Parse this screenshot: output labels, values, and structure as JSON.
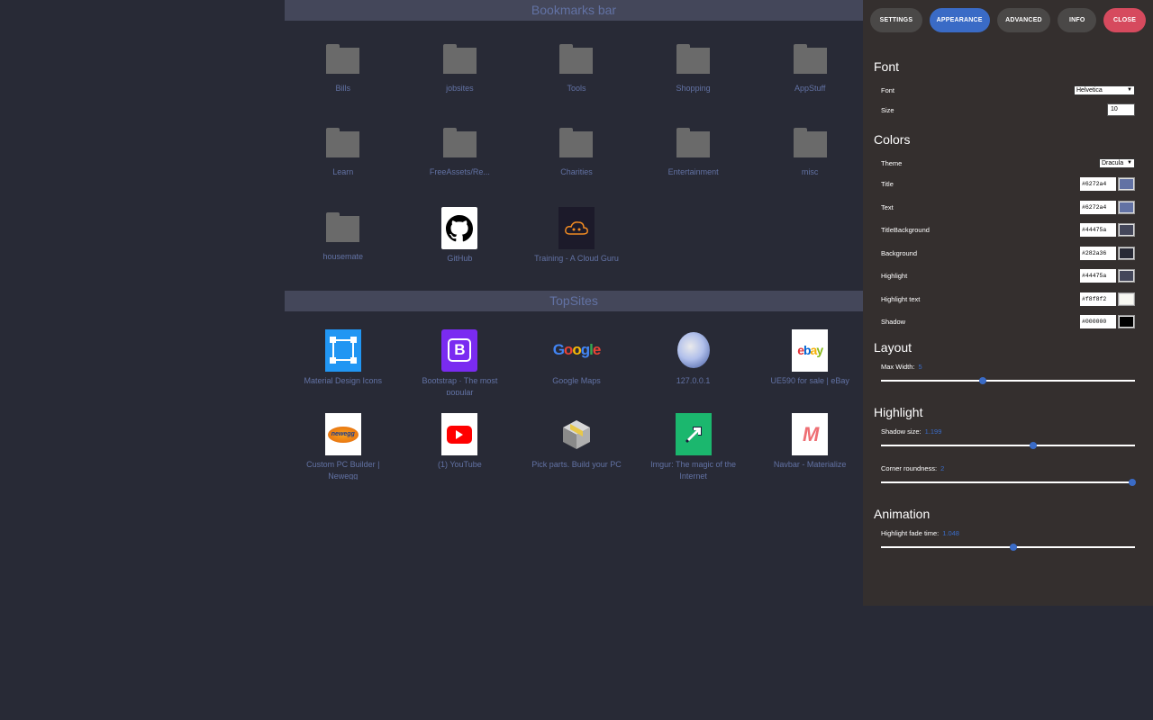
{
  "bookmarks": {
    "header": "Bookmarks bar",
    "items": [
      {
        "label": "Bills",
        "icon": "folder-icon"
      },
      {
        "label": "jobsites",
        "icon": "folder-icon"
      },
      {
        "label": "Tools",
        "icon": "folder-icon"
      },
      {
        "label": "Shopping",
        "icon": "folder-icon"
      },
      {
        "label": "AppStuff",
        "icon": "folder-icon"
      },
      {
        "label": "Learn",
        "icon": "folder-icon"
      },
      {
        "label": "FreeAssets/Re...",
        "icon": "folder-icon"
      },
      {
        "label": "Charities",
        "icon": "folder-icon"
      },
      {
        "label": "Entertainment",
        "icon": "folder-icon"
      },
      {
        "label": "misc",
        "icon": "folder-icon"
      },
      {
        "label": "housemate",
        "icon": "folder-icon"
      },
      {
        "label": "GitHub",
        "icon": "github-icon"
      },
      {
        "label": "Training - A Cloud Guru",
        "icon": "acloudguru-icon"
      }
    ]
  },
  "topsites": {
    "header": "TopSites",
    "items": [
      {
        "label": "Material Design Icons",
        "icon": "material-design-icon"
      },
      {
        "label": "Bootstrap · The most popular",
        "icon": "bootstrap-icon"
      },
      {
        "label": "Google Maps",
        "icon": "google-icon"
      },
      {
        "label": "127.0.0.1",
        "icon": "globe-icon"
      },
      {
        "label": "UE590 for sale | eBay",
        "icon": "ebay-icon"
      },
      {
        "label": "Custom PC Builder | Newegg",
        "icon": "newegg-icon"
      },
      {
        "label": "(1) YouTube",
        "icon": "youtube-icon"
      },
      {
        "label": "Pick parts. Build your PC",
        "icon": "pcpartpicker-icon"
      },
      {
        "label": "Imgur: The magic of the Internet",
        "icon": "imgur-icon"
      },
      {
        "label": "Navbar - Materialize",
        "icon": "materialize-icon"
      }
    ]
  },
  "panel": {
    "tabs": {
      "settings": "SETTINGS",
      "appearance": "APPEARANCE",
      "advanced": "ADVANCED",
      "info": "INFO",
      "close": "CLOSE"
    },
    "font": {
      "heading": "Font",
      "font_label": "Font",
      "font_value": "Helvetica",
      "size_label": "Size",
      "size_value": "10"
    },
    "colors": {
      "heading": "Colors",
      "theme_label": "Theme",
      "theme_value": "Dracula",
      "items": [
        {
          "label": "Title",
          "hex": "#6272a4",
          "color": "#6272a4"
        },
        {
          "label": "Text",
          "hex": "#6272a4",
          "color": "#6272a4"
        },
        {
          "label": "TitleBackground",
          "hex": "#44475a",
          "color": "#44475a"
        },
        {
          "label": "Background",
          "hex": "#282a36",
          "color": "#282a36"
        },
        {
          "label": "Highlight",
          "hex": "#44475a",
          "color": "#44475a"
        },
        {
          "label": "Highlight text",
          "hex": "#f8f8f2",
          "color": "#f8f8f2"
        },
        {
          "label": "Shadow",
          "hex": "#000000",
          "color": "#000000"
        }
      ]
    },
    "layout": {
      "heading": "Layout",
      "max_width_label": "Max Width:",
      "max_width_value": "5",
      "max_width_fraction": 0.4
    },
    "highlight": {
      "heading": "Highlight",
      "shadow_label": "Shadow size:",
      "shadow_value": "1.199",
      "shadow_fraction": 0.6,
      "corner_label": "Corner roundness:",
      "corner_value": "2",
      "corner_fraction": 0.99
    },
    "animation": {
      "heading": "Animation",
      "fade_label": "Highlight fade time:",
      "fade_value": "1.048",
      "fade_fraction": 0.52
    }
  },
  "colors": {
    "background": "#282a36",
    "title_background": "#44475a",
    "text": "#6272a4",
    "panel_background": "#342f2e",
    "accent": "#3a6bc6",
    "close": "#d64a5e"
  }
}
